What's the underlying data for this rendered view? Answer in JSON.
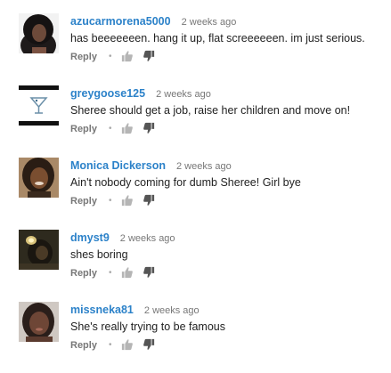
{
  "comments": [
    {
      "author": "azucarmorena5000",
      "time": "2 weeks ago",
      "text": "has beeeeeeen. hang it up, flat screeeeeen. im just serious.",
      "reply": "Reply"
    },
    {
      "author": "greygoose125",
      "time": "2 weeks ago",
      "text": "Sheree should get a job, raise her children and move on!",
      "reply": "Reply"
    },
    {
      "author": "Monica Dickerson",
      "time": "2 weeks ago",
      "text": "Ain't nobody coming for dumb Sheree! Girl bye",
      "reply": "Reply"
    },
    {
      "author": "dmyst9",
      "time": "2 weeks ago",
      "text": "shes boring",
      "reply": "Reply"
    },
    {
      "author": "missneka81",
      "time": "2 weeks ago",
      "text": "She's really trying to be famous",
      "reply": "Reply"
    }
  ],
  "icons": {
    "separator": "dot-separator",
    "like": "thumbs-up-icon",
    "dislike": "thumbs-down-icon"
  },
  "colors": {
    "author_link": "#2c82c9",
    "meta_text": "#777777",
    "body_text": "#222222",
    "vote_icon": "#b5b5b5"
  }
}
